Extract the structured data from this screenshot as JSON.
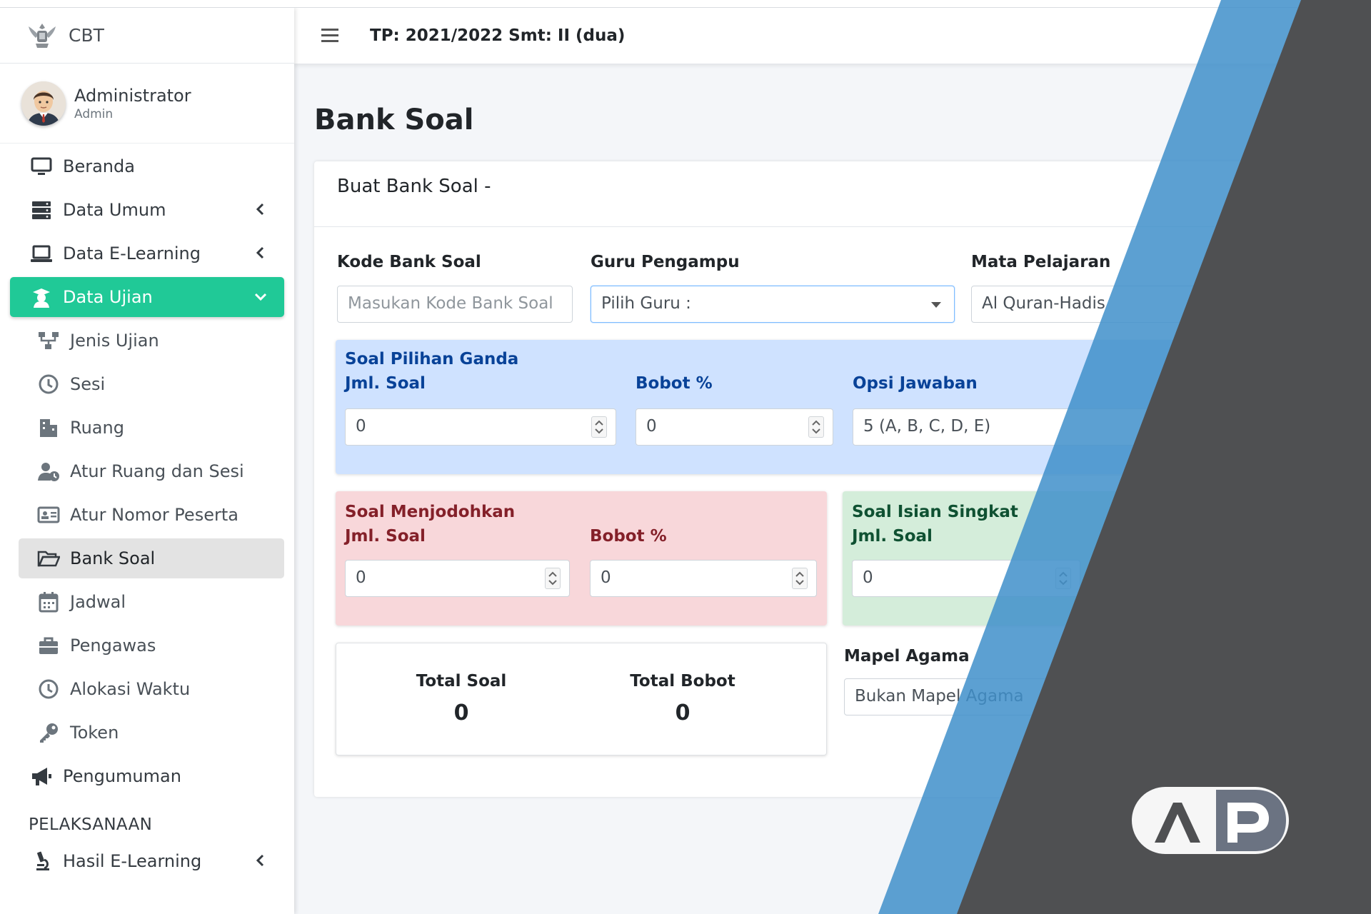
{
  "brand": {
    "name": "CBT"
  },
  "user": {
    "name": "Administrator",
    "role": "Admin"
  },
  "sidebar": {
    "items": [
      {
        "label": "Beranda"
      },
      {
        "label": "Data Umum"
      },
      {
        "label": "Data E-Learning"
      },
      {
        "label": "Data Ujian"
      }
    ],
    "subitems": [
      {
        "label": "Jenis Ujian"
      },
      {
        "label": "Sesi"
      },
      {
        "label": "Ruang"
      },
      {
        "label": "Atur Ruang dan Sesi"
      },
      {
        "label": "Atur Nomor Peserta"
      },
      {
        "label": "Bank Soal"
      },
      {
        "label": "Jadwal"
      },
      {
        "label": "Pengawas"
      },
      {
        "label": "Alokasi Waktu"
      },
      {
        "label": "Token"
      }
    ],
    "announcement": {
      "label": "Pengumuman"
    },
    "section_header": "PELAKSANAAN",
    "hasil": {
      "label": "Hasil E-Learning"
    }
  },
  "navbar": {
    "title": "TP: 2021/2022 Smt: II (dua)"
  },
  "page": {
    "title": "Bank Soal"
  },
  "form": {
    "card_title": "Buat Bank Soal -",
    "kode": {
      "label": "Kode Bank Soal",
      "placeholder": "Masukan Kode Bank Soal"
    },
    "guru": {
      "label": "Guru Pengampu",
      "value": "Pilih Guru :"
    },
    "mapel": {
      "label": "Mata Pelajaran",
      "value": "Al Quran-Hadis"
    },
    "pg": {
      "title": "Soal Pilihan Ganda",
      "jml_label": "Jml. Soal",
      "jml_value": "0",
      "bobot_label": "Bobot %",
      "bobot_value": "0",
      "opsi_label": "Opsi Jawaban",
      "opsi_value": "5 (A, B, C, D, E)"
    },
    "jodoh": {
      "title": "Soal Menjodohkan",
      "jml_label": "Jml. Soal",
      "jml_value": "0",
      "bobot_label": "Bobot %",
      "bobot_value": "0"
    },
    "isian": {
      "title": "Soal Isian Singkat",
      "jml_label": "Jml. Soal",
      "jml_value": "0"
    },
    "totals": {
      "soal_label": "Total Soal",
      "soal_value": "0",
      "bobot_label": "Total Bobot",
      "bobot_value": "0"
    },
    "mapel_agama": {
      "label": "Mapel Agama",
      "value": "Bukan Mapel Agama"
    }
  },
  "colors": {
    "active": "#20c997",
    "overlay_dark": "#4f5052",
    "overlay_blue": "#3f8fca"
  },
  "icons": [
    "garuda-icon",
    "monitor-icon",
    "server-icon",
    "laptop-icon",
    "graduation-icon",
    "sitemap-icon",
    "clock-icon",
    "building-icon",
    "user-clock-icon",
    "id-card-icon",
    "folder-open-icon",
    "calendar-icon",
    "briefcase-icon",
    "key-icon",
    "megaphone-icon",
    "microscope-icon",
    "chevron-left-icon",
    "chevron-down-icon",
    "hamburger-icon"
  ]
}
